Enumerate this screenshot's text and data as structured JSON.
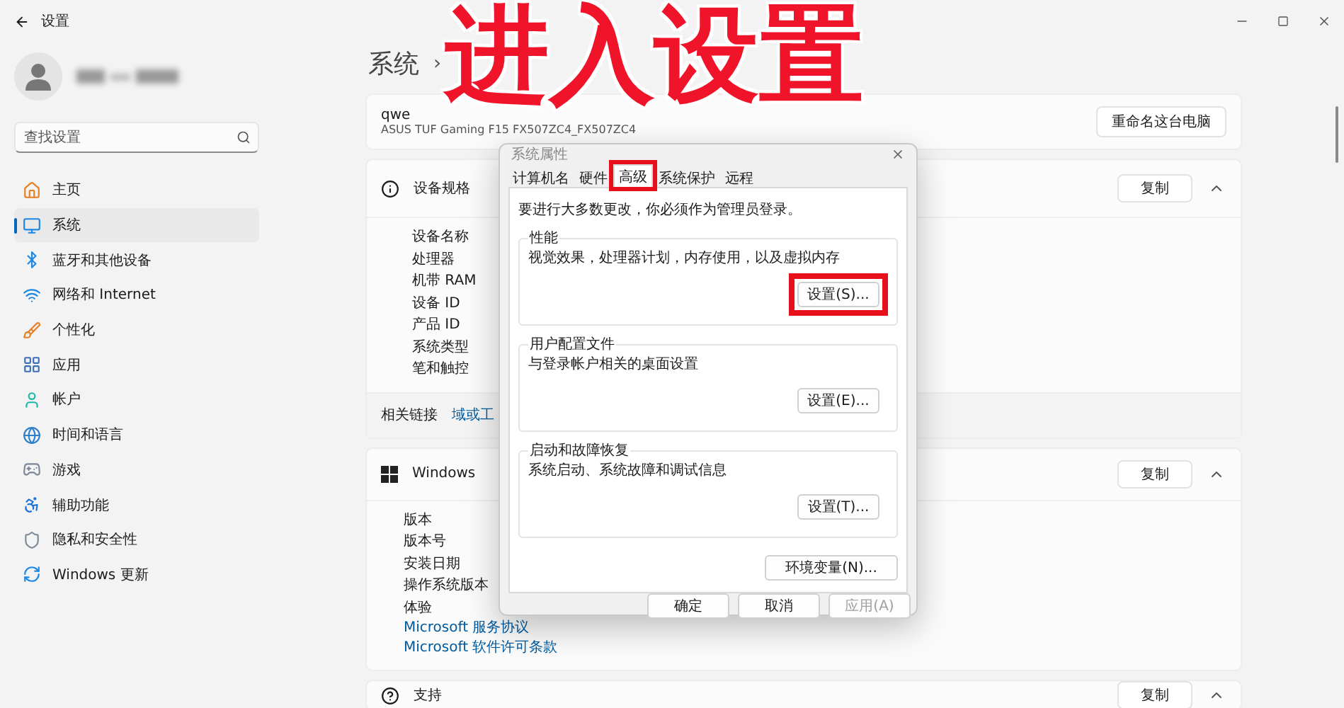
{
  "window": {
    "title": "设置"
  },
  "sidebar": {
    "search": {
      "placeholder": "查找设置"
    },
    "items": [
      {
        "label": "主页",
        "selected": false
      },
      {
        "label": "系统",
        "selected": true
      },
      {
        "label": "蓝牙和其他设备",
        "selected": false
      },
      {
        "label": "网络和 Internet",
        "selected": false
      },
      {
        "label": "个性化",
        "selected": false
      },
      {
        "label": "应用",
        "selected": false
      },
      {
        "label": "帐户",
        "selected": false
      },
      {
        "label": "时间和语言",
        "selected": false
      },
      {
        "label": "游戏",
        "selected": false
      },
      {
        "label": "辅助功能",
        "selected": false
      },
      {
        "label": "隐私和安全性",
        "selected": false
      },
      {
        "label": "Windows 更新",
        "selected": false
      }
    ]
  },
  "breadcrumb": {
    "section": "系统",
    "separator": "›"
  },
  "annotation": {
    "text": "进入设置"
  },
  "device_card": {
    "name": "qwe",
    "model": "ASUS TUF Gaming F15 FX507ZC4_FX507ZC4",
    "button": "重命名这台电脑"
  },
  "device_specs": {
    "title": "设备规格",
    "copy": "复制",
    "expanded": true,
    "labels": [
      "设备名称",
      "处理器",
      "机带 RAM",
      "设备 ID",
      "产品 ID",
      "系统类型",
      "笔和触控"
    ],
    "related_label": "相关链接",
    "related_link": "域或工"
  },
  "windows_specs": {
    "title": "Windows",
    "copy": "复制",
    "expanded": true,
    "labels": [
      "版本",
      "版本号",
      "安装日期",
      "操作系统版本",
      "体验"
    ],
    "links": [
      "Microsoft 服务协议",
      "Microsoft 软件许可条款"
    ]
  },
  "support": {
    "title": "支持",
    "copy": "复制",
    "expanded": true
  },
  "dialog": {
    "title": "系统属性",
    "tabs": [
      {
        "label": "计算机名",
        "selected": false,
        "annotated": false
      },
      {
        "label": "硬件",
        "selected": false,
        "annotated": false
      },
      {
        "label": "高级",
        "selected": true,
        "annotated": true
      },
      {
        "label": "系统保护",
        "selected": false,
        "annotated": false
      },
      {
        "label": "远程",
        "selected": false,
        "annotated": false
      }
    ],
    "notice": "要进行大多数更改，你必须作为管理员登录。",
    "groups": [
      {
        "title": "性能",
        "description": "视觉效果，处理器计划，内存使用，以及虚拟内存",
        "button": "设置(S)...",
        "annotated": true
      },
      {
        "title": "用户配置文件",
        "description": "与登录帐户相关的桌面设置",
        "button": "设置(E)...",
        "annotated": false
      },
      {
        "title": "启动和故障恢复",
        "description": "系统启动、系统故障和调试信息",
        "button": "设置(T)...",
        "annotated": false
      }
    ],
    "env_button": "环境变量(N)...",
    "buttons": [
      {
        "label": "确定",
        "disabled": false
      },
      {
        "label": "取消",
        "disabled": false
      },
      {
        "label": "应用(A)",
        "disabled": true
      }
    ]
  }
}
